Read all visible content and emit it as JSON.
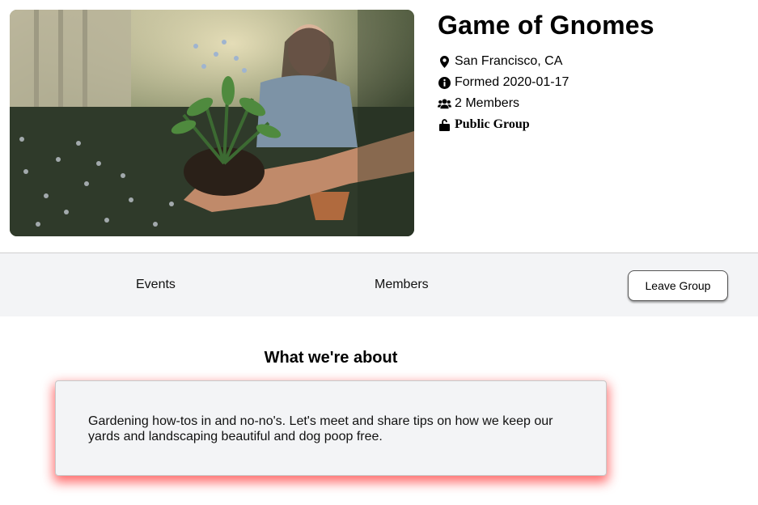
{
  "group": {
    "title": "Game of Gnomes",
    "location": "San Francisco, CA",
    "formed": "Formed 2020-01-17",
    "members": "2 Members",
    "privacy": "Public Group"
  },
  "icons": {
    "location": "map-marker-icon",
    "formed": "info-circle-icon",
    "members": "users-icon",
    "privacy": "unlock-icon"
  },
  "nav": {
    "events_label": "Events",
    "members_label": "Members",
    "leave_label": "Leave Group"
  },
  "about": {
    "heading": "What we're about",
    "description": "Gardening how-tos in and no-no's. Let's meet and share tips on how we keep our yards and landscaping beautiful and dog poop free."
  },
  "colors": {
    "nav_background": "#f3f4f6",
    "card_glow": "#ff1e1e"
  }
}
